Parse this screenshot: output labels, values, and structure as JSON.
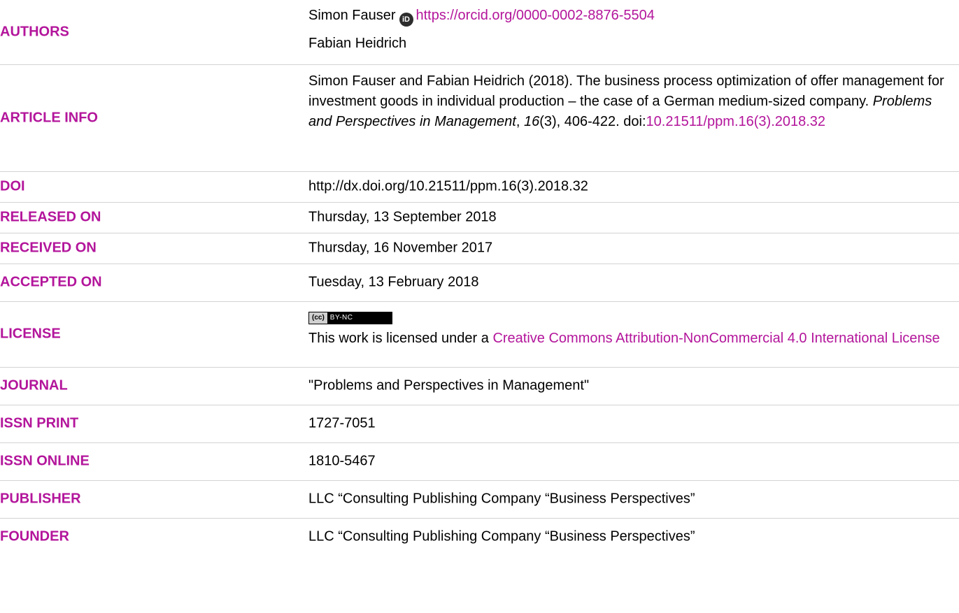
{
  "authors": {
    "label": "AUTHORS",
    "author1_name": "Simon Fauser",
    "orcid_url": "https://orcid.org/0000-0002-8876-5504",
    "author2_name": "Fabian Heidrich"
  },
  "article_info": {
    "label": "ARTICLE INFO",
    "citation_prefix": "Simon Fauser and Fabian Heidrich (2018). The business process optimization of offer management for investment goods in individual production – the case of a German medium-sized company. ",
    "journal_italic": "Problems and Perspectives in Management",
    "after_journal": ", ",
    "volume_italic": "16",
    "after_volume": "(3), 406-422. doi:",
    "doi_link": "10.21511/ppm.16(3).2018.32"
  },
  "doi": {
    "label": "DOI",
    "value": "http://dx.doi.org/10.21511/ppm.16(3).2018.32"
  },
  "released": {
    "label": "RELEASED ON",
    "value": "Thursday, 13 September 2018"
  },
  "received": {
    "label": "RECEIVED ON",
    "value": "Thursday, 16 November 2017"
  },
  "accepted": {
    "label": "ACCEPTED ON",
    "value": "Tuesday, 13 February 2018"
  },
  "license": {
    "label": "LICENSE",
    "badge_cc": "(cc)",
    "badge_terms": "BY-NC",
    "text_prefix": "This work is licensed under a ",
    "link_text": "Creative Commons Attribution-NonCommercial 4.0 International License"
  },
  "journal": {
    "label": "JOURNAL",
    "value": "\"Problems and Perspectives in Management\""
  },
  "issn_print": {
    "label": "ISSN PRINT",
    "value": "1727-7051"
  },
  "issn_online": {
    "label": "ISSN ONLINE",
    "value": "1810-5467"
  },
  "publisher": {
    "label": "PUBLISHER",
    "value": "LLC “Consulting Publishing Company “Business Perspectives”"
  },
  "founder": {
    "label": "FOUNDER",
    "value": "LLC “Consulting Publishing Company “Business Perspectives”"
  },
  "colors": {
    "label": "#b3159b",
    "link": "#b3159b",
    "divider": "#d3d3d3"
  },
  "icons": {
    "orcid": "orcid-icon",
    "license_badge": "cc-by-nc-badge"
  }
}
